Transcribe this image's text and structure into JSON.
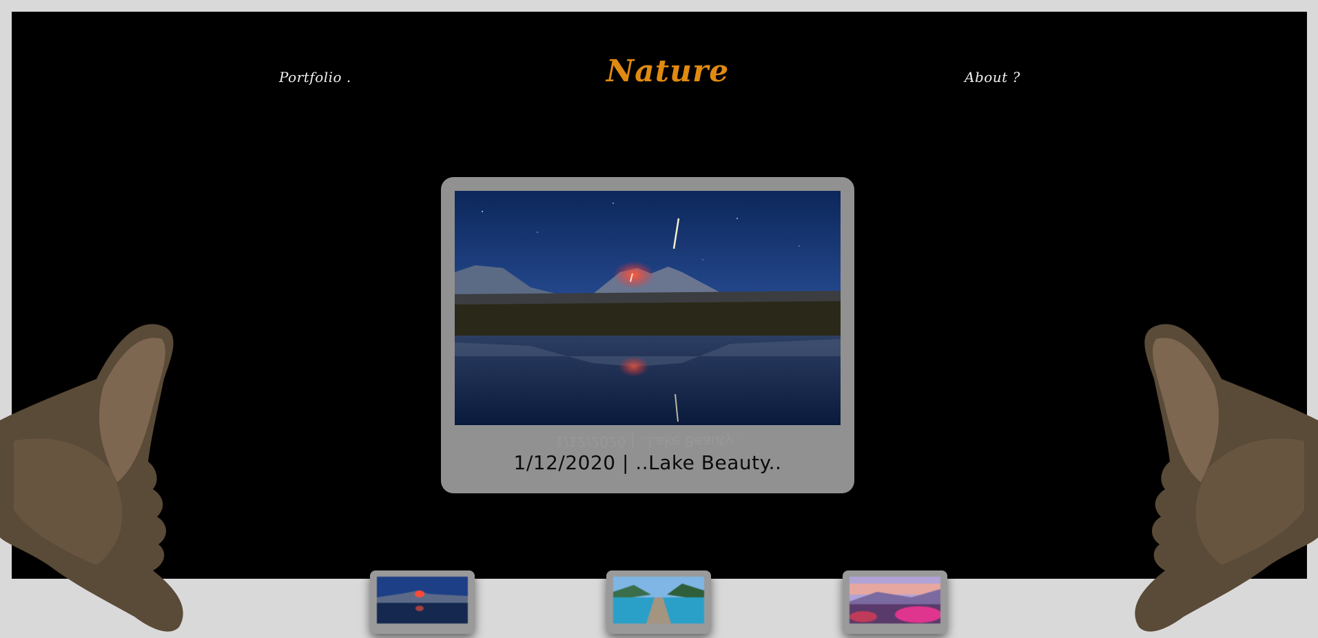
{
  "nav": {
    "portfolio_label": "Portfolio .",
    "brand": "Nature",
    "about_label": "About ?"
  },
  "featured": {
    "caption": "1/12/2020 | ..Lake Beauty.."
  },
  "thumbnails": [
    {
      "name": "volcano-lake"
    },
    {
      "name": "pier-lake"
    },
    {
      "name": "pink-flower-valley"
    }
  ],
  "colors": {
    "page_background": "#d9d9d9",
    "stage_background": "#000000",
    "brand_accent": "#e08a12",
    "card_background": "#919191"
  }
}
